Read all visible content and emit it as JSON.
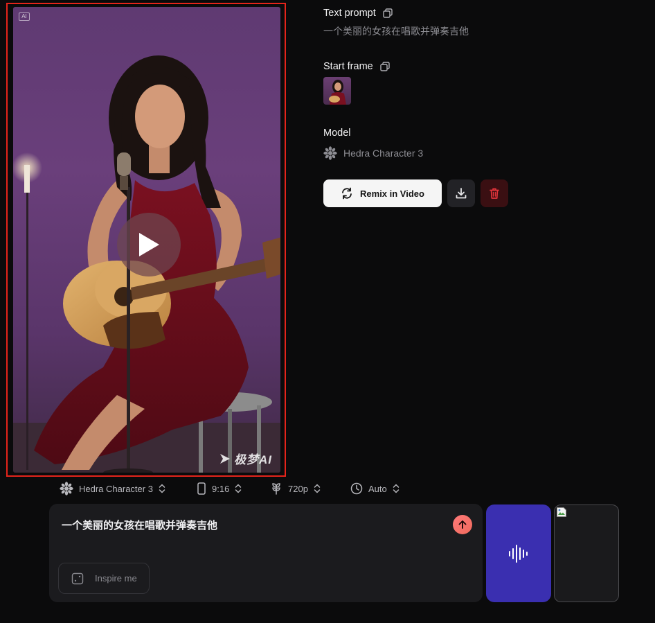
{
  "preview": {
    "ai_badge": "AI",
    "watermark": "极梦AI"
  },
  "info": {
    "text_prompt_label": "Text prompt",
    "text_prompt_value": "一个美丽的女孩在唱歌并弹奏吉他",
    "start_frame_label": "Start frame",
    "model_label": "Model",
    "model_value": "Hedra Character 3",
    "remix_label": "Remix in Video"
  },
  "settings": {
    "model": "Hedra Character 3",
    "aspect_ratio": "9:16",
    "resolution": "720p",
    "duration": "Auto"
  },
  "composer": {
    "prompt_text": "一个美丽的女孩在唱歌并弹奏吉他",
    "inspire_label": "Inspire me"
  },
  "colors": {
    "accent_audio": "#3a2fb0",
    "send_button": "#f06a5c",
    "delete_bg": "#3a0f12",
    "delete_icon": "#e2353b",
    "highlight_border": "#e5241b"
  }
}
